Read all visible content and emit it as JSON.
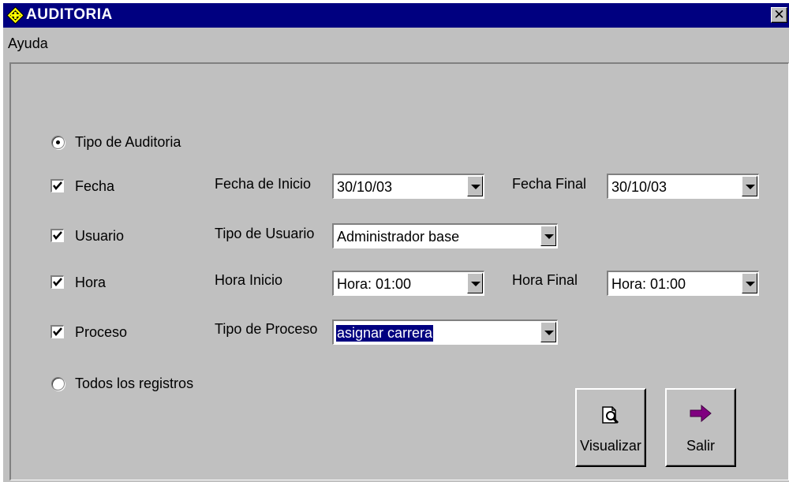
{
  "window": {
    "title": "AUDITORIA"
  },
  "menu": {
    "items": [
      "Ayuda"
    ]
  },
  "form": {
    "tipo_auditoria": {
      "label": "Tipo de Auditoria",
      "selected": true
    },
    "todos_registros": {
      "label": "Todos los registros",
      "selected": false
    },
    "fecha": {
      "label": "Fecha",
      "checked": true,
      "inicio_label": "Fecha de  Inicio",
      "inicio_value": "30/10/03",
      "final_label": "Fecha Final",
      "final_value": "30/10/03"
    },
    "usuario": {
      "label": "Usuario",
      "checked": true,
      "tipo_label": "Tipo de Usuario",
      "tipo_value": "Administrador base"
    },
    "hora": {
      "label": "Hora",
      "checked": true,
      "inicio_label": "Hora Inicio",
      "inicio_value": "Hora: 01:00",
      "final_label": "Hora Final",
      "final_value": "Hora: 01:00"
    },
    "proceso": {
      "label": "Proceso",
      "checked": true,
      "tipo_label": "Tipo de Proceso",
      "tipo_value": "asignar carrera"
    }
  },
  "buttons": {
    "visualizar": "Visualizar",
    "salir": "Salir"
  },
  "icons": {
    "app": "warning-diamond-icon",
    "close": "close-icon",
    "visualizar": "magnifier-page-icon",
    "salir": "arrow-right-icon"
  },
  "colors": {
    "titlebar": "#000080",
    "face": "#c0c0c0",
    "selection": "#000080",
    "arrow": "#800080"
  }
}
